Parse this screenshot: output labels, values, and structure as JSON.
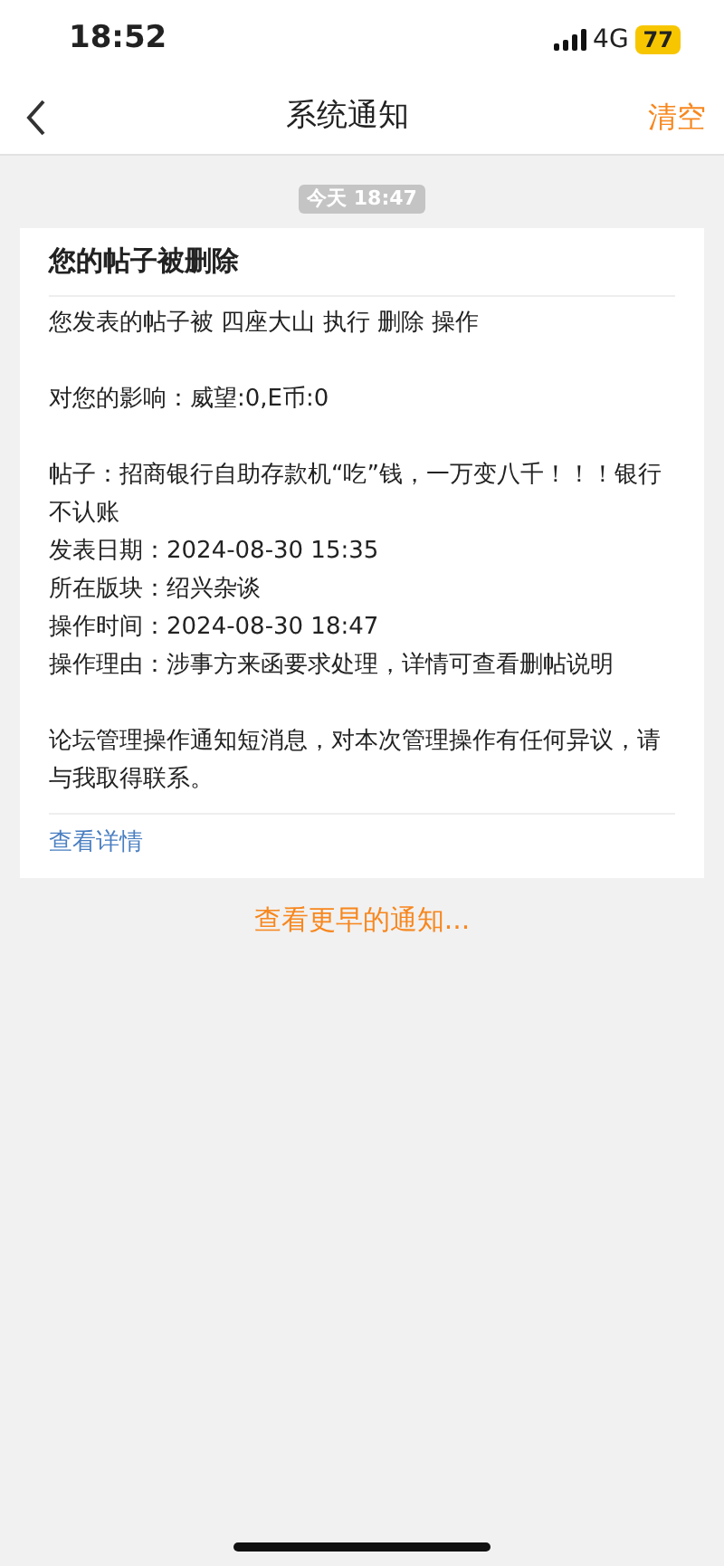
{
  "status_bar": {
    "time": "18:52",
    "network": "4G",
    "battery": "77"
  },
  "nav": {
    "title": "系统通知",
    "action": "清空"
  },
  "timestamp": "今天 18:47",
  "notice": {
    "title": "您的帖子被删除",
    "paragraphs": [
      [
        "您发表的帖子被 四座大山 执行 删除 操作"
      ],
      [
        "对您的影响：威望:0,E币:0"
      ],
      [
        "帖子：招商银行自助存款机“吃”钱，一万变八千！！！银行不认账",
        "发表日期：2024-08-30 15:35",
        "所在版块：绍兴杂谈",
        "操作时间：2024-08-30 18:47",
        "操作理由：涉事方来函要求处理，详情可查看删帖说明"
      ],
      [
        "论坛管理操作通知短消息，对本次管理操作有任何异议，请与我取得联系。"
      ]
    ],
    "link": "查看详情"
  },
  "more": "查看更早的通知..."
}
